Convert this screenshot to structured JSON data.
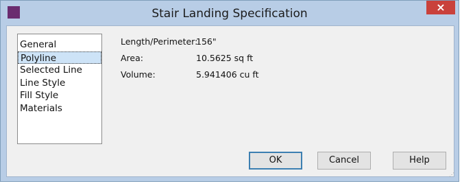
{
  "window": {
    "title": "Stair Landing Specification",
    "close_glyph": "×",
    "icon": "app-icon"
  },
  "sidebar": {
    "items": [
      {
        "label": "General"
      },
      {
        "label": "Polyline",
        "selected": true
      },
      {
        "label": "Selected Line"
      },
      {
        "label": "Line Style"
      },
      {
        "label": "Fill Style"
      },
      {
        "label": "Materials"
      }
    ]
  },
  "properties": [
    {
      "label": "Length/Perimeter:",
      "value": "156\""
    },
    {
      "label": "Area:",
      "value": "10.5625 sq ft"
    },
    {
      "label": "Volume:",
      "value": "5.941406 cu ft"
    }
  ],
  "buttons": {
    "ok": "OK",
    "cancel": "Cancel",
    "help": "Help"
  },
  "colors": {
    "close_button": "#c9413b",
    "selection": "#cde3f7",
    "ok_border": "#3c7fb1"
  }
}
